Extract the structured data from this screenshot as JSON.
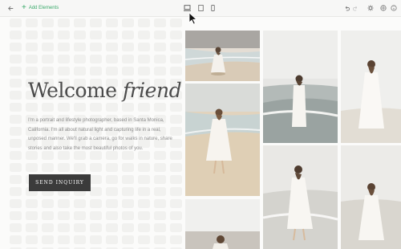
{
  "toolbar": {
    "add_elements_label": "Add Elements",
    "back_icon": "back-arrow-icon",
    "add_icon": "plus-icon",
    "device_icons": [
      "desktop-icon",
      "tablet-icon",
      "mobile-icon"
    ],
    "undo_icon": "undo-icon",
    "redo_icon": "redo-icon",
    "right_icons": [
      "gear-icon",
      "layers-icon",
      "help-icon"
    ]
  },
  "hero": {
    "headline_regular": "Welcome",
    "headline_italic": "friend",
    "paragraph": "I'm a portrait and lifestyle photographer, based in Santa Monica, California. I'm all about natural light and capturing life in a real, unposed manner. We'll grab a camera, go for walks in nature, share stories and also take the most beautiful photos of you.",
    "cta_label": "SEND INQUIRY"
  },
  "colors": {
    "accent_green": "#3aa96a",
    "button_dark": "#3b3b3b",
    "page_bg": "#fbfbfa"
  }
}
